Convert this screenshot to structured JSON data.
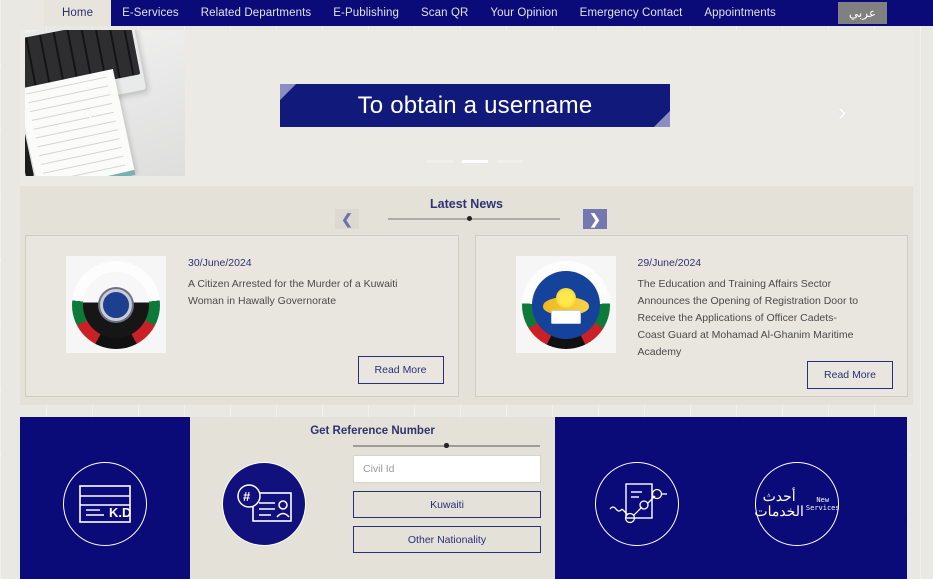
{
  "nav": {
    "items": [
      {
        "label": "Home",
        "active": true
      },
      {
        "label": "E-Services",
        "active": false
      },
      {
        "label": "Related Departments",
        "active": false
      },
      {
        "label": "E-Publishing",
        "active": false
      },
      {
        "label": "Scan QR",
        "active": false
      },
      {
        "label": "Your Opinion",
        "active": false
      },
      {
        "label": "Emergency Contact",
        "active": false
      },
      {
        "label": "Appointments",
        "active": false
      }
    ],
    "lang_toggle": "عربي"
  },
  "hero": {
    "banner_title": "To obtain a username",
    "prev_icon": "‹",
    "next_icon": "›",
    "slide_count": 3,
    "active_slide": 2
  },
  "news": {
    "title": "Latest News",
    "prev_icon": "❮",
    "next_icon": "❯",
    "cards": [
      {
        "date": "30/June/2024",
        "text": "A Citizen Arrested for the Murder of a Kuwaiti Woman in Hawally Governorate",
        "read_more": "Read More",
        "logo": "ministry-of-interior-emblem"
      },
      {
        "date": "29/June/2024",
        "text": "The Education and Training Affairs Sector Announces the Opening of Registration Door to Receive the Applications of Officer Cadets-Coast Guard at Mohamad Al-Ghanim Maritime Academy",
        "read_more": "Read More",
        "logo": "education-training-emblem"
      }
    ]
  },
  "reference": {
    "title": "Get Reference Number",
    "input_placeholder": "Civil Id",
    "input_value": "",
    "kuwaiti_label": "Kuwaiti",
    "other_label": "Other Nationality"
  },
  "quick_icons": {
    "kd": {
      "name": "payment-card-icon",
      "label": "K.D"
    },
    "hash": {
      "name": "reference-number-icon",
      "label": "#"
    },
    "flow": {
      "name": "service-flow-icon",
      "label": ""
    },
    "new_services": {
      "ar": "أحدث الخدمات",
      "en_line1": "New",
      "en_line2": "Services"
    }
  },
  "colors": {
    "navy": "#0a0a78",
    "banner_navy": "#111a7a",
    "accent_purple": "#7578ae",
    "page_bg": "#eae8e2",
    "panel_bg": "#e4e1d9",
    "link_blue": "#2a2f7a"
  }
}
